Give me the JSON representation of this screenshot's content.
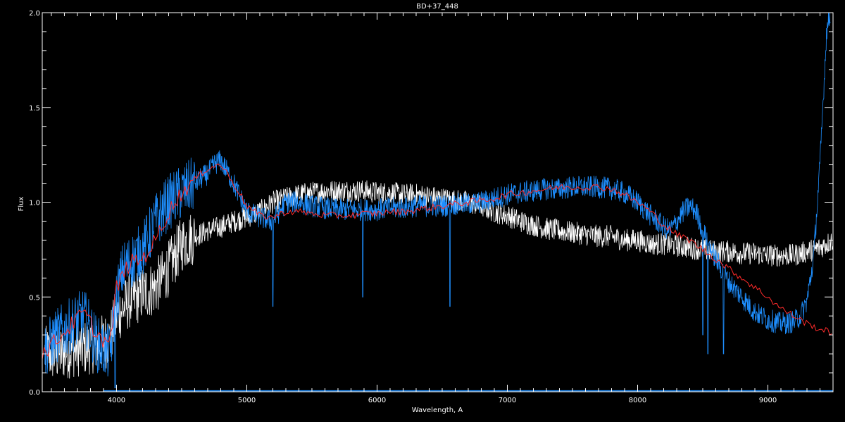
{
  "chart_data": {
    "type": "line",
    "title": "BD+37_448",
    "xlabel": "Wavelength, A",
    "ylabel": "Flux",
    "xlim": [
      3430,
      9500
    ],
    "ylim": [
      0.0,
      2.0
    ],
    "x_ticks": [
      4000,
      5000,
      6000,
      7000,
      8000,
      9000
    ],
    "x_tick_labels": [
      "4000",
      "5000",
      "6000",
      "7000",
      "8000",
      "9000"
    ],
    "y_ticks": [
      0.0,
      0.5,
      1.0,
      1.5,
      2.0
    ],
    "y_tick_labels": [
      "0.0",
      "0.5",
      "1.0",
      "1.5",
      "2.0"
    ],
    "grid": false,
    "background": "#000000",
    "axis_color": "#ffffff",
    "series": [
      {
        "color": "#ffffff",
        "x": [
          3450,
          3550,
          3650,
          3750,
          3850,
          3950,
          4000,
          4100,
          4200,
          4300,
          4400,
          4500,
          4600,
          4700,
          4800,
          4900,
          5000,
          5100,
          5200,
          5300,
          5400,
          5500,
          5600,
          5700,
          5800,
          5900,
          6000,
          6100,
          6200,
          6300,
          6400,
          6500,
          6600,
          6700,
          6800,
          6900,
          7000,
          7100,
          7200,
          7300,
          7400,
          7500,
          7600,
          7700,
          7800,
          7900,
          8000,
          8100,
          8200,
          8300,
          8400,
          8500,
          8600,
          8700,
          8800,
          8900,
          9000,
          9100,
          9200,
          9300,
          9400,
          9500
        ],
        "y": [
          0.2,
          0.2,
          0.22,
          0.23,
          0.25,
          0.28,
          0.4,
          0.48,
          0.52,
          0.55,
          0.65,
          0.78,
          0.82,
          0.85,
          0.87,
          0.9,
          0.92,
          0.95,
          1.0,
          1.02,
          1.04,
          1.05,
          1.06,
          1.06,
          1.06,
          1.06,
          1.05,
          1.05,
          1.04,
          1.04,
          1.03,
          1.02,
          1.01,
          1.0,
          0.98,
          0.95,
          0.93,
          0.9,
          0.88,
          0.86,
          0.85,
          0.84,
          0.83,
          0.82,
          0.82,
          0.8,
          0.8,
          0.78,
          0.78,
          0.77,
          0.76,
          0.75,
          0.74,
          0.74,
          0.73,
          0.73,
          0.72,
          0.72,
          0.72,
          0.74,
          0.76,
          0.8
        ],
        "noise": 0.05
      },
      {
        "color": "#1e8fff",
        "x": [
          3450,
          3550,
          3650,
          3750,
          3850,
          3950,
          4000,
          4050,
          4100,
          4200,
          4300,
          4400,
          4500,
          4600,
          4700,
          4750,
          4800,
          4900,
          5000,
          5100,
          5200,
          5300,
          5400,
          5500,
          5600,
          5700,
          5800,
          5900,
          6000,
          6100,
          6200,
          6300,
          6400,
          6500,
          6600,
          6700,
          6800,
          6900,
          7000,
          7100,
          7200,
          7300,
          7400,
          7500,
          7600,
          7700,
          7800,
          7900,
          8000,
          8100,
          8200,
          8250,
          8300,
          8350,
          8400,
          8450,
          8500,
          8600,
          8700,
          8800,
          8900,
          9000,
          9100,
          9200,
          9250,
          9300,
          9350,
          9400,
          9450,
          9480
        ],
        "y": [
          0.22,
          0.3,
          0.35,
          0.4,
          0.25,
          0.2,
          0.5,
          0.65,
          0.68,
          0.75,
          0.9,
          1.0,
          1.05,
          1.1,
          1.15,
          1.2,
          1.22,
          1.1,
          0.95,
          0.92,
          0.9,
          1.0,
          1.0,
          0.98,
          0.97,
          0.96,
          0.96,
          0.96,
          0.96,
          0.97,
          0.97,
          0.98,
          0.98,
          0.98,
          0.99,
          0.99,
          1.0,
          1.02,
          1.04,
          1.05,
          1.06,
          1.07,
          1.07,
          1.08,
          1.08,
          1.08,
          1.07,
          1.05,
          1.0,
          0.93,
          0.87,
          0.85,
          0.9,
          0.95,
          0.98,
          0.95,
          0.85,
          0.7,
          0.58,
          0.5,
          0.42,
          0.38,
          0.36,
          0.37,
          0.4,
          0.48,
          0.7,
          1.2,
          1.9,
          2.0
        ],
        "noise": 0.05,
        "dips": [
          [
            3990,
            0.02
          ],
          [
            5200,
            0.45
          ],
          [
            5890,
            0.5
          ],
          [
            6560,
            0.45
          ],
          [
            8500,
            0.3
          ],
          [
            8540,
            0.2
          ],
          [
            8660,
            0.2
          ]
        ]
      },
      {
        "color": "#ff2a2a",
        "x": [
          3430,
          3550,
          3650,
          3750,
          3850,
          3950,
          4000,
          4100,
          4200,
          4300,
          4400,
          4500,
          4600,
          4700,
          4800,
          4900,
          5000,
          5100,
          5200,
          5300,
          5400,
          5500,
          5600,
          5700,
          5800,
          5900,
          6000,
          6100,
          6200,
          6300,
          6400,
          6500,
          6600,
          6700,
          6800,
          6900,
          7000,
          7100,
          7200,
          7300,
          7400,
          7500,
          7600,
          7700,
          7800,
          7900,
          8000,
          8100,
          8200,
          8300,
          8400,
          8500,
          8600,
          8700,
          8800,
          8900,
          9000,
          9100,
          9200,
          9300,
          9400,
          9500
        ],
        "y": [
          0.2,
          0.28,
          0.35,
          0.42,
          0.3,
          0.25,
          0.55,
          0.68,
          0.7,
          0.8,
          0.95,
          1.05,
          1.12,
          1.18,
          1.2,
          1.1,
          0.98,
          0.93,
          0.92,
          0.95,
          0.95,
          0.94,
          0.93,
          0.93,
          0.93,
          0.94,
          0.94,
          0.95,
          0.95,
          0.96,
          0.97,
          0.98,
          0.99,
          1.0,
          1.01,
          1.02,
          1.04,
          1.05,
          1.06,
          1.07,
          1.08,
          1.08,
          1.08,
          1.08,
          1.07,
          1.04,
          1.0,
          0.95,
          0.88,
          0.83,
          0.8,
          0.75,
          0.7,
          0.65,
          0.6,
          0.55,
          0.5,
          0.44,
          0.4,
          0.36,
          0.33,
          0.31
        ],
        "noise": 0.015
      }
    ]
  }
}
